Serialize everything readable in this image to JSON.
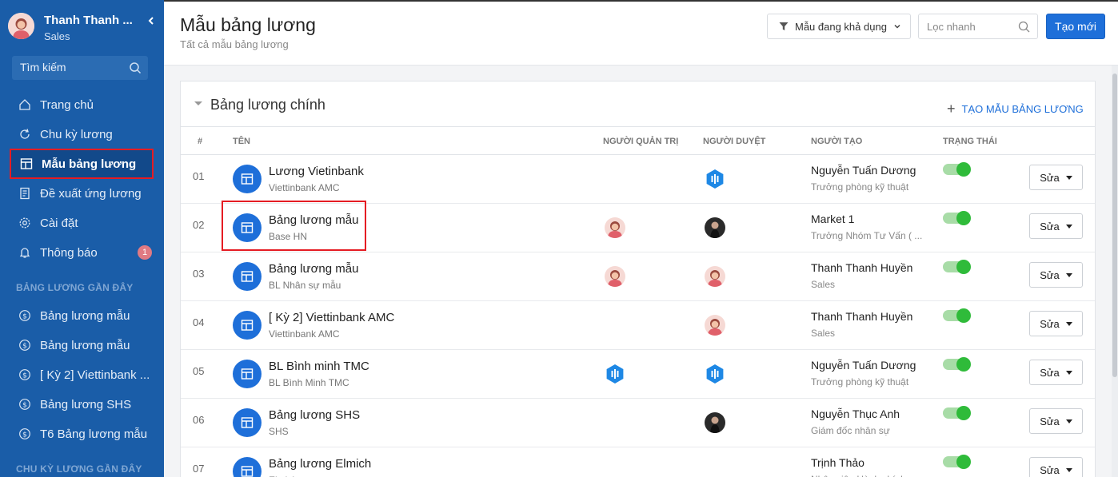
{
  "sidebar": {
    "user_name": "Thanh Thanh ...",
    "user_role": "Sales",
    "search_placeholder": "Tìm kiếm",
    "nav": [
      {
        "label": "Trang chủ",
        "icon": "home-icon"
      },
      {
        "label": "Chu kỳ lương",
        "icon": "refresh-icon"
      },
      {
        "label": "Mẫu bảng lương",
        "icon": "table-icon",
        "active": true
      },
      {
        "label": "Đề xuất ứng lương",
        "icon": "document-icon"
      },
      {
        "label": "Cài đặt",
        "icon": "gear-icon"
      },
      {
        "label": "Thông báo",
        "icon": "bell-icon",
        "badge": "1"
      }
    ],
    "recent_templates_title": "BẢNG LƯƠNG GẦN ĐÂY",
    "recent_templates": [
      "Bảng lương mẫu",
      "Bảng lương mẫu",
      "[ Kỳ 2] Viettinbank ...",
      "Bảng lương SHS",
      "T6 Bảng lương mẫu"
    ],
    "recent_cycles_title": "CHU KỲ LƯƠNG GẦN ĐÂY"
  },
  "header": {
    "title": "Mẫu bảng lương",
    "subtitle": "Tất cả mẫu bảng lương",
    "filter_label": "Mẫu đang khả dụng",
    "quick_filter_placeholder": "Lọc nhanh",
    "create_label": "Tạo mới"
  },
  "card": {
    "title": "Bảng lương chính",
    "add_label": "TẠO MẪU BẢNG LƯƠNG",
    "columns": {
      "index": "#",
      "name": "TÊN",
      "admin": "NGƯỜI QUẢN TRỊ",
      "approver": "NGƯỜI DUYỆT",
      "creator": "NGƯỜI TẠO",
      "status": "TRẠNG THÁI"
    },
    "edit_label": "Sửa",
    "rows": [
      {
        "index": "01",
        "name": "Lương Vietinbank",
        "sub": "Viettinbank AMC",
        "admin": "",
        "approver": "logo-avatar",
        "creator": "Nguyễn Tuấn Dương",
        "creator_role": "Trưởng phòng kỹ thuật",
        "active": true
      },
      {
        "index": "02",
        "name": "Bảng lương mẫu",
        "sub": "Base HN",
        "admin": "female-avatar",
        "approver": "dark-avatar",
        "creator": "Market 1",
        "creator_role": "Trưởng Nhóm Tư Vấn ( ...",
        "active": true
      },
      {
        "index": "03",
        "name": "Bảng lương mẫu",
        "sub": "BL Nhân sự mẫu",
        "admin": "female-avatar",
        "approver": "female-avatar",
        "creator": "Thanh Thanh Huyền",
        "creator_role": "Sales",
        "active": true
      },
      {
        "index": "04",
        "name": "[ Kỳ 2] Viettinbank AMC",
        "sub": "Viettinbank AMC",
        "admin": "",
        "approver": "female-avatar",
        "creator": "Thanh Thanh Huyền",
        "creator_role": "Sales",
        "active": true
      },
      {
        "index": "05",
        "name": "BL Bình minh TMC",
        "sub": "BL Bình Minh TMC",
        "admin": "logo-avatar",
        "approver": "logo-avatar",
        "creator": "Nguyễn Tuấn Dương",
        "creator_role": "Trưởng phòng kỹ thuật",
        "active": true
      },
      {
        "index": "06",
        "name": "Bảng lương SHS",
        "sub": "SHS",
        "admin": "",
        "approver": "dark-avatar",
        "creator": "Nguyễn Thục Anh",
        "creator_role": "Giám đốc nhân sự",
        "active": true
      },
      {
        "index": "07",
        "name": "Bảng lương Elmich",
        "sub": "Elmich",
        "admin": "",
        "approver": "",
        "creator": "Trịnh Thảo",
        "creator_role": "Nhân viên Hành chính",
        "active": true
      }
    ]
  },
  "colors": {
    "sidebar": "#1a5da8",
    "primary": "#1e6fd9",
    "highlight": "#e51c23",
    "toggle_on": "#2fbb3a"
  }
}
